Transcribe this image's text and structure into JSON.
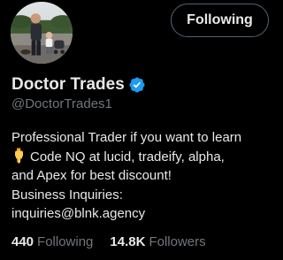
{
  "profile": {
    "display_name": "Doctor Trades",
    "handle": "@DoctorTrades1",
    "verified_icon": "verified-badge-icon",
    "verified_color": "#1d9bf0",
    "follow_button_label": "Following",
    "bio": {
      "line1": "Professional Trader if you want to learn",
      "line2_emoji": "pointing-down-hand-emoji",
      "line2": "Code NQ at lucid, tradeify, alpha,",
      "line3": "and Apex for best discount!",
      "line4": "Business Inquiries:",
      "line5": "inquiries@blnk.agency"
    },
    "stats": {
      "following_count": "440",
      "following_label": "Following",
      "followers_count": "14.8K",
      "followers_label": "Followers"
    }
  },
  "colors": {
    "background": "#000000",
    "primary_text": "#e7e9ea",
    "secondary_text": "#71767b",
    "button_border": "#536471"
  }
}
